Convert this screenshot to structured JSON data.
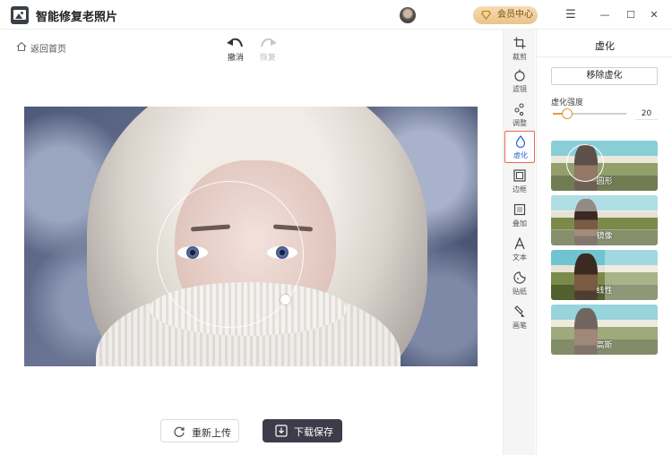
{
  "app": {
    "title": "智能修复老照片"
  },
  "header": {
    "vip_label": "会员中心",
    "min": "—",
    "max": "☐",
    "close": "✕",
    "menu": "☰"
  },
  "nav": {
    "back_label": "返回首页"
  },
  "history": {
    "undo_label": "撤消",
    "redo_label": "恢复"
  },
  "actions": {
    "reupload_label": "重新上传",
    "save_label": "下载保存"
  },
  "tools": [
    {
      "label": "裁剪",
      "icon": "crop-icon",
      "active": false
    },
    {
      "label": "滤镜",
      "icon": "filter-icon",
      "active": false
    },
    {
      "label": "调整",
      "icon": "adjust-icon",
      "active": false
    },
    {
      "label": "虚化",
      "icon": "blur-drop-icon",
      "active": true
    },
    {
      "label": "边框",
      "icon": "frame-icon",
      "active": false
    },
    {
      "label": "叠加",
      "icon": "overlay-icon",
      "active": false
    },
    {
      "label": "文本",
      "icon": "text-icon",
      "active": false
    },
    {
      "label": "贴纸",
      "icon": "sticker-icon",
      "active": false
    },
    {
      "label": "画笔",
      "icon": "brush-icon",
      "active": false
    }
  ],
  "panel": {
    "title": "虚化",
    "remove_label": "移除虚化",
    "strength_label": "虚化强度",
    "strength_value": "20",
    "strength_fraction": 0.2,
    "modes": [
      {
        "label": "圆形"
      },
      {
        "label": "镜像"
      },
      {
        "label": "线性"
      },
      {
        "label": "高斯"
      }
    ]
  },
  "colors": {
    "accent": "#e89a3e",
    "active_border": "#e96b4f",
    "active_text": "#2a64d6",
    "save_bg": "#3e3b4a"
  }
}
